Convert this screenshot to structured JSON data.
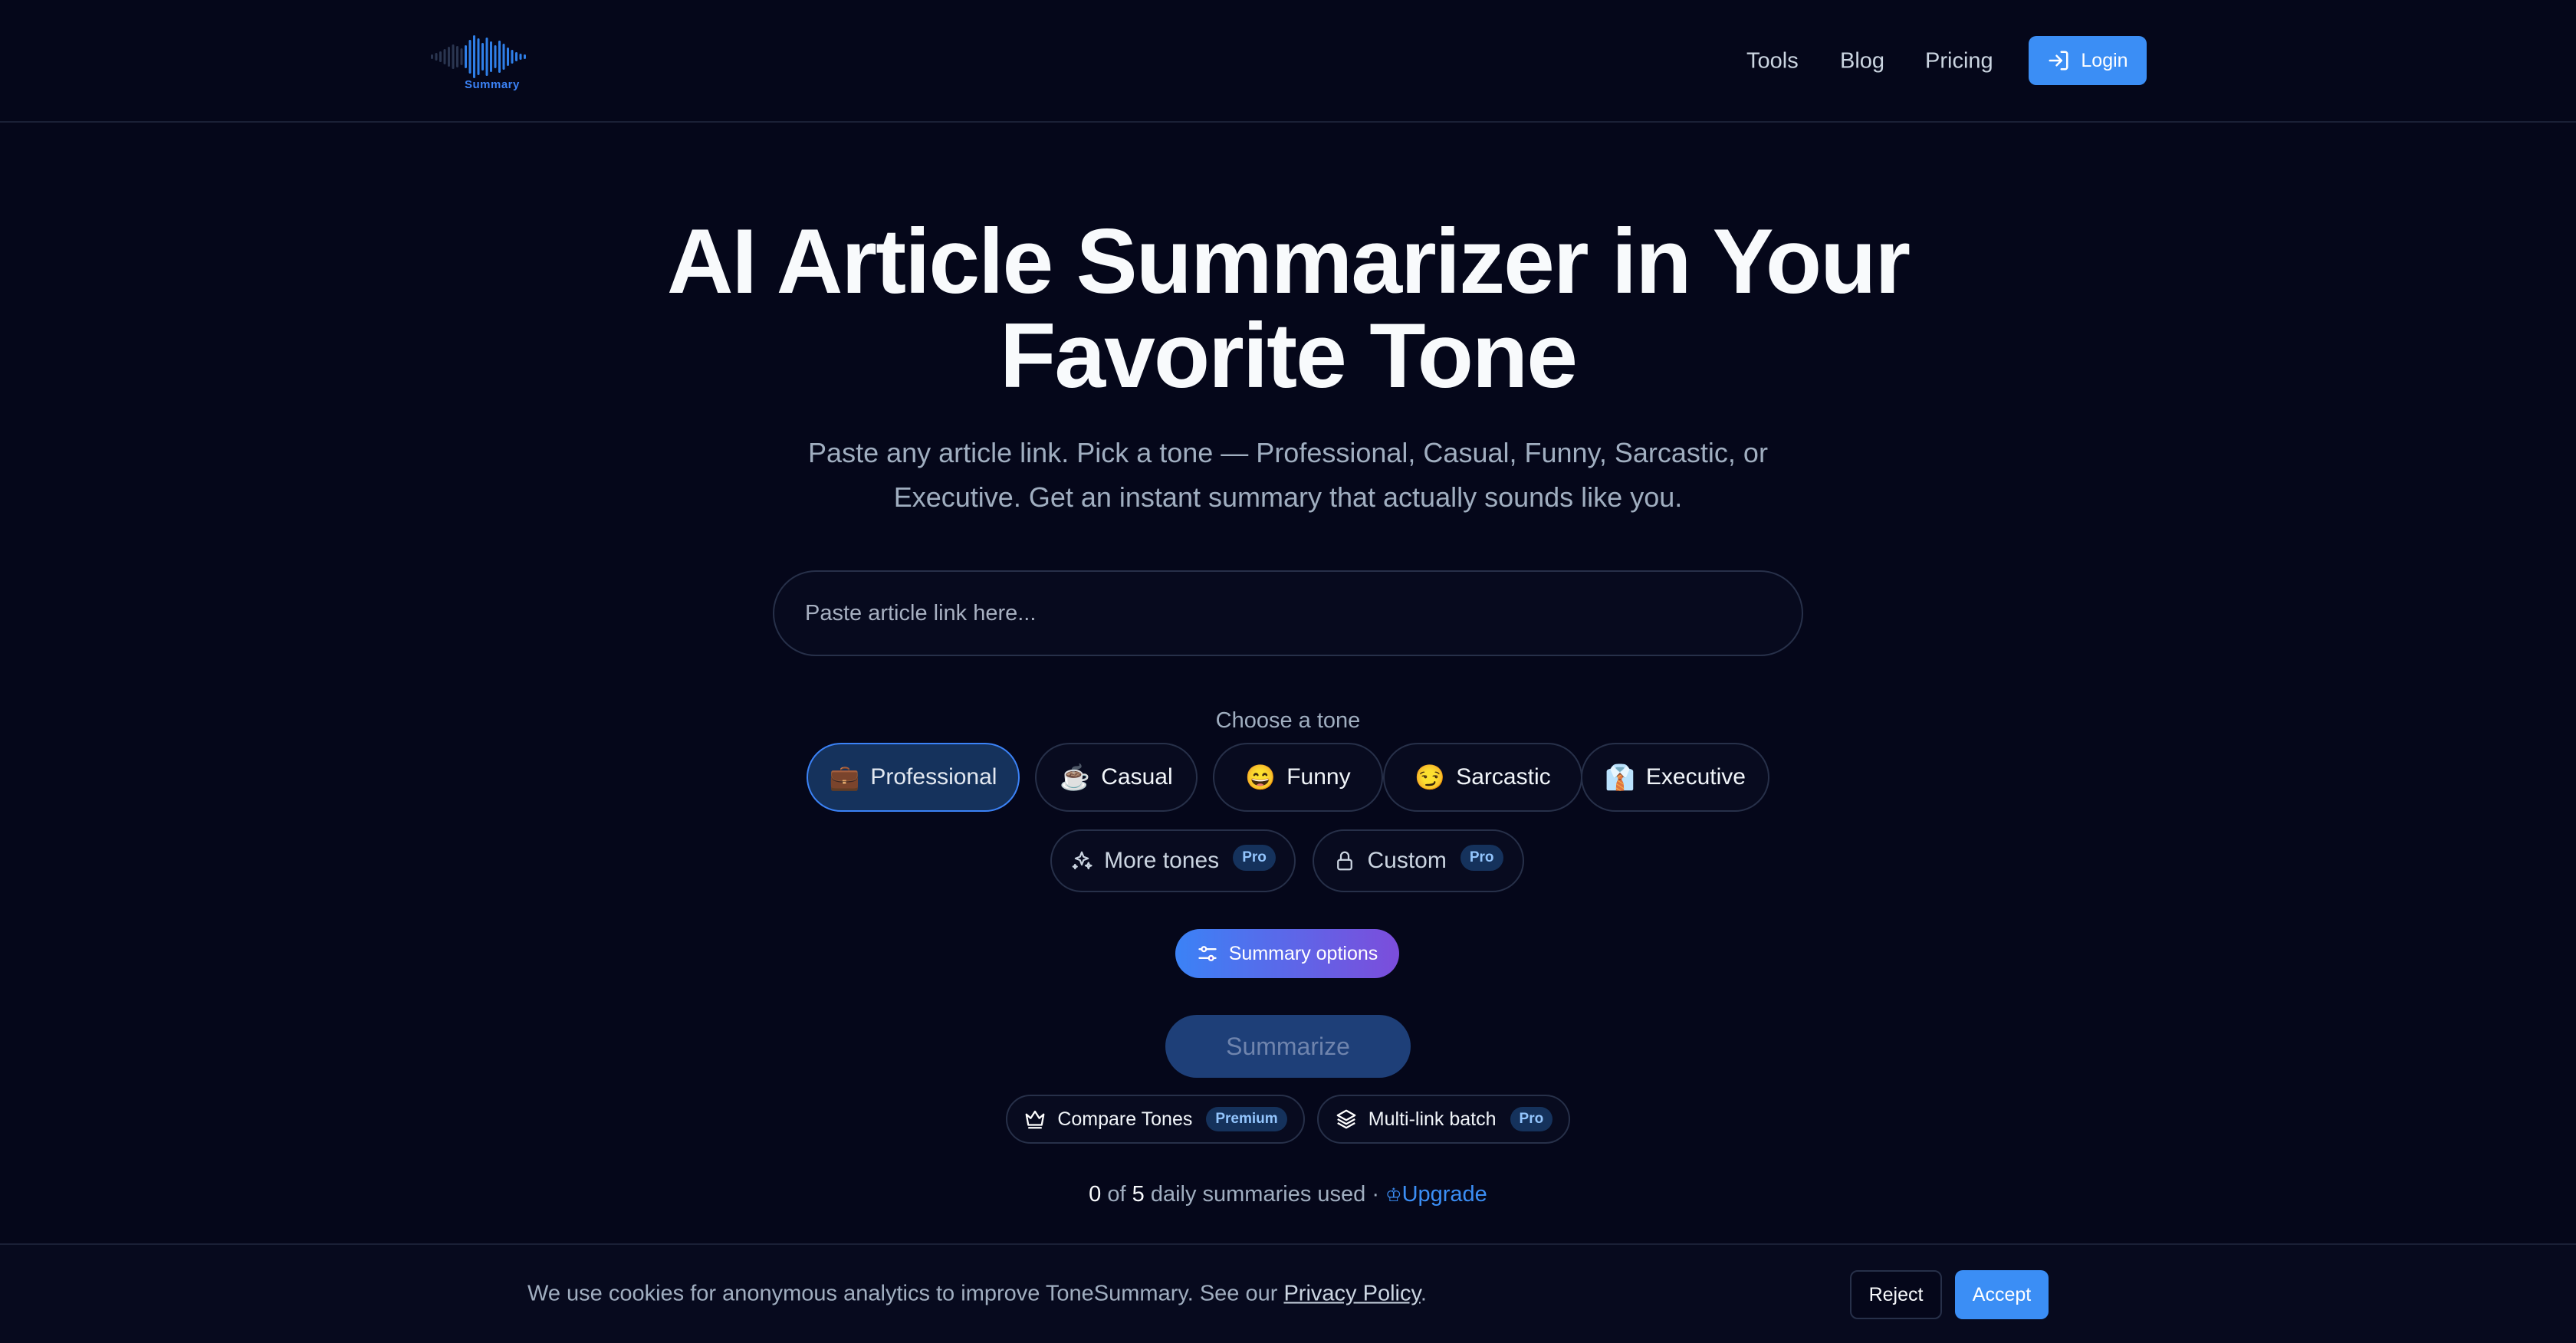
{
  "header": {
    "logo_caption": "Summary",
    "nav": [
      {
        "label": "Tools"
      },
      {
        "label": "Blog"
      },
      {
        "label": "Pricing"
      }
    ],
    "login_label": "Login"
  },
  "hero": {
    "title_line1": "AI Article Summarizer in Your",
    "title_line2": "Favorite Tone",
    "subtitle_line1": "Paste any article link. Pick a tone — Professional, Casual, Funny, Sarcastic, or",
    "subtitle_line2": "Executive. Get an instant summary that actually sounds like you."
  },
  "search": {
    "value": "",
    "placeholder": "Paste article link here..."
  },
  "tones": {
    "label": "Choose a tone",
    "items": [
      {
        "label": "Professional",
        "emoji": "💼",
        "selected": true
      },
      {
        "label": "Casual",
        "emoji": "☕",
        "selected": false
      },
      {
        "label": "Funny",
        "emoji": "😄",
        "selected": false
      },
      {
        "label": "Sarcastic",
        "emoji": "😏",
        "selected": false
      },
      {
        "label": "Executive",
        "emoji": "👔",
        "selected": false
      }
    ],
    "more_label": "More tones",
    "more_badge": "Pro",
    "custom_label": "Custom",
    "custom_badge": "Pro"
  },
  "actions": {
    "options_label": "Summary options",
    "summarize_label": "Summarize",
    "compare_label": "Compare Tones",
    "compare_badge": "Premium",
    "batch_label": "Multi-link batch",
    "batch_badge": "Pro"
  },
  "usage": {
    "used": "0",
    "of_text": " of ",
    "limit": "5",
    "suffix": " daily summaries used · ",
    "upgrade_label": "Upgrade"
  },
  "cookie": {
    "text": "We use cookies for anonymous analytics to improve ToneSummary. See our ",
    "policy_link": "Privacy Policy",
    "period": ".",
    "reject_label": "Reject",
    "accept_label": "Accept"
  },
  "colors": {
    "background": "#05071a",
    "accent": "#3b8ef5",
    "gradient_end": "#7c4ddb",
    "selected_chip": "#15325c"
  }
}
